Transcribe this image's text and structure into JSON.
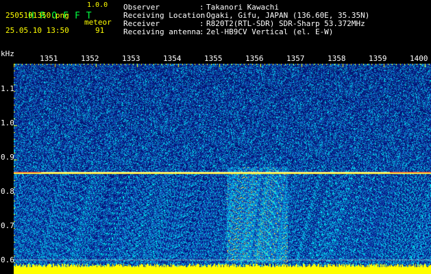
{
  "header": {
    "app_title": "HROFFT",
    "version": "1.0.0",
    "filename": "2505101350.png",
    "datetime": "25.05.10 13:50",
    "meteor_label": "meteor",
    "meteor_count": "91",
    "info": [
      {
        "label": "Observer",
        "value": "Takanori Kawachi"
      },
      {
        "label": "Receiving Location",
        "value": "Ogaki, Gifu, JAPAN (136.60E, 35.35N)"
      },
      {
        "label": "Receiver",
        "value": "R820T2(RTL-SDR) SDR-Sharp 53.372MHz"
      },
      {
        "label": "Receiving antenna",
        "value": "2el-HB9CV Vertical (el. E-W)"
      }
    ],
    "colon": ":"
  },
  "axes": {
    "y_unit": "kHz",
    "y_ticks": [
      {
        "label": "1.1",
        "value": 1.1
      },
      {
        "label": "1.0",
        "value": 1.0
      },
      {
        "label": "0.9",
        "value": 0.9
      },
      {
        "label": "0.8",
        "value": 0.8
      },
      {
        "label": "0.7",
        "value": 0.7
      },
      {
        "label": "0.6",
        "value": 0.6
      }
    ],
    "x_ticks": [
      "1351",
      "1352",
      "1353",
      "1354",
      "1355",
      "1356",
      "1357",
      "1358",
      "1359",
      "1400"
    ],
    "colors": {
      "text": "#ffffff",
      "header": "#00ff40",
      "tick": "#ffff00",
      "background": "#000000"
    }
  },
  "spectrogram": {
    "y_range_khz": [
      0.58,
      1.18
    ],
    "carrier_khz": 0.87,
    "colors": {
      "noise_low": "#0b1c7a",
      "noise_mid": "#1d58d8",
      "signal": "#00e8ff",
      "peak": "#ff3030",
      "bar": "#ffff00"
    }
  }
}
